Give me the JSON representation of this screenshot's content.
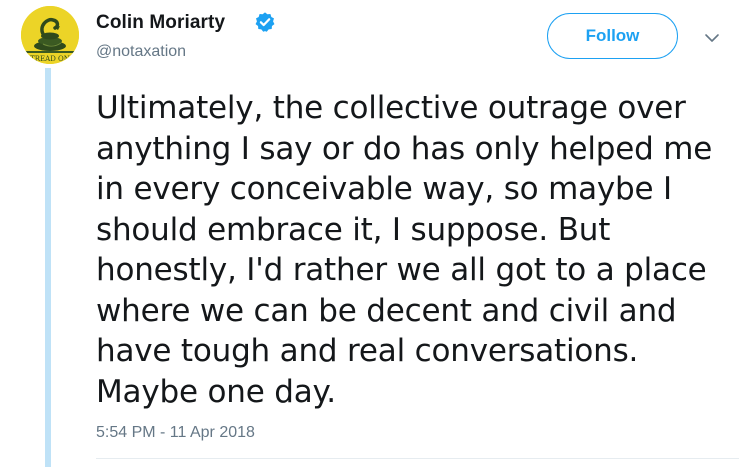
{
  "author": {
    "display_name": "Colin Moriarty",
    "handle": "@notaxation",
    "verified": true,
    "avatar": {
      "icon": "gadsden-flag-snake-icon",
      "text": "TREAD ON",
      "background_color": "#ecd427"
    }
  },
  "actions": {
    "follow_label": "Follow",
    "more_icon": "chevron-down-icon"
  },
  "tweet": {
    "text": "Ultimately, the collective outrage over anything I say or do has only helped me in every conceivable way, so maybe I should embrace it, I suppose. But honestly, I'd rather we all got to a place where we can be decent and civil and have tough and real conversations. Maybe one day.",
    "timestamp": "5:54 PM - 11 Apr 2018"
  },
  "colors": {
    "accent": "#1da1f2",
    "thread_line": "#bfe2f7",
    "secondary_text": "#657786",
    "primary_text": "#14171a"
  }
}
